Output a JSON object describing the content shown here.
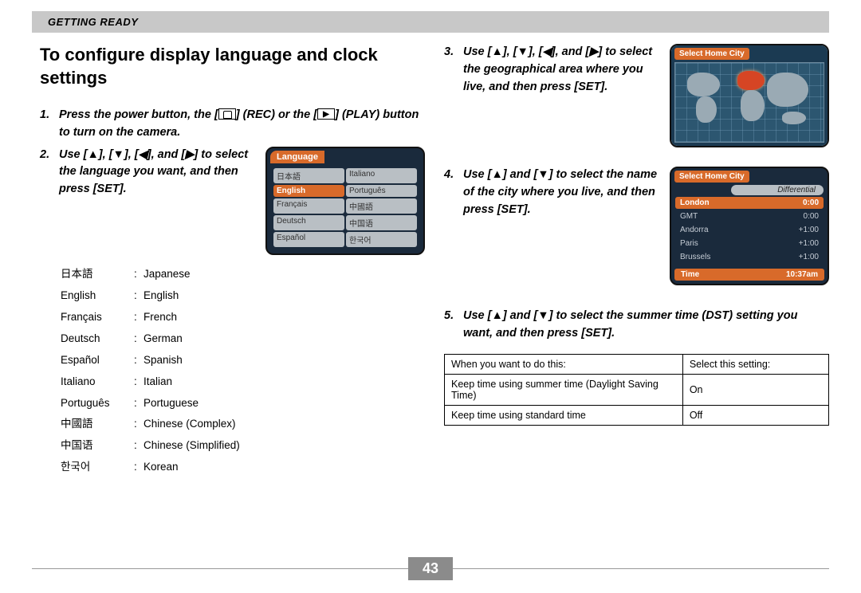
{
  "header": "GETTING READY",
  "title": "To configure display language and clock settings",
  "steps": {
    "s1": {
      "num": "1.",
      "text_before": "Press the power button, the [",
      "rec": "] (REC) or the [",
      "play": "] (PLAY) button to turn on the camera."
    },
    "s2": {
      "num": "2.",
      "text": "Use [▲], [▼], [◀], and [▶] to select the language you want, and then press [SET]."
    },
    "s3": {
      "num": "3.",
      "text": "Use [▲], [▼], [◀], and [▶] to select the geographical area where you live, and then press [SET]."
    },
    "s4": {
      "num": "4.",
      "text": "Use [▲] and [▼] to select the name of the city where you live, and then press [SET]."
    },
    "s5": {
      "num": "5.",
      "text": "Use [▲] and [▼] to select the summer time (DST) setting you want, and then press [SET]."
    }
  },
  "lcd_lang": {
    "title": "Language",
    "items": [
      "日本語",
      "Italiano",
      "English",
      "Português",
      "Français",
      "中國語",
      "Deutsch",
      "中国语",
      "Español",
      "한국어"
    ]
  },
  "lang_map": [
    [
      "日本語",
      "Japanese"
    ],
    [
      "English",
      "English"
    ],
    [
      "Français",
      "French"
    ],
    [
      "Deutsch",
      "German"
    ],
    [
      "Español",
      "Spanish"
    ],
    [
      "Italiano",
      "Italian"
    ],
    [
      "Português",
      "Portuguese"
    ],
    [
      "中國語",
      "Chinese (Complex)"
    ],
    [
      "中国语",
      "Chinese (Simplified)"
    ],
    [
      "한국어",
      "Korean"
    ]
  ],
  "lcd_map": {
    "title": "Select Home City"
  },
  "lcd_city": {
    "title": "Select Home City",
    "diff": "Differential",
    "rows": [
      [
        "London",
        "0:00"
      ],
      [
        "GMT",
        "0:00"
      ],
      [
        "Andorra",
        "+1:00"
      ],
      [
        "Paris",
        "+1:00"
      ],
      [
        "Brussels",
        "+1:00"
      ]
    ],
    "time_label": "Time",
    "time_value": "10:37am"
  },
  "dst": {
    "head": [
      "When you want to do this:",
      "Select this setting:"
    ],
    "rows": [
      [
        "Keep time using summer time (Daylight Saving Time)",
        "On"
      ],
      [
        "Keep time using standard time",
        "Off"
      ]
    ]
  },
  "page_number": "43"
}
